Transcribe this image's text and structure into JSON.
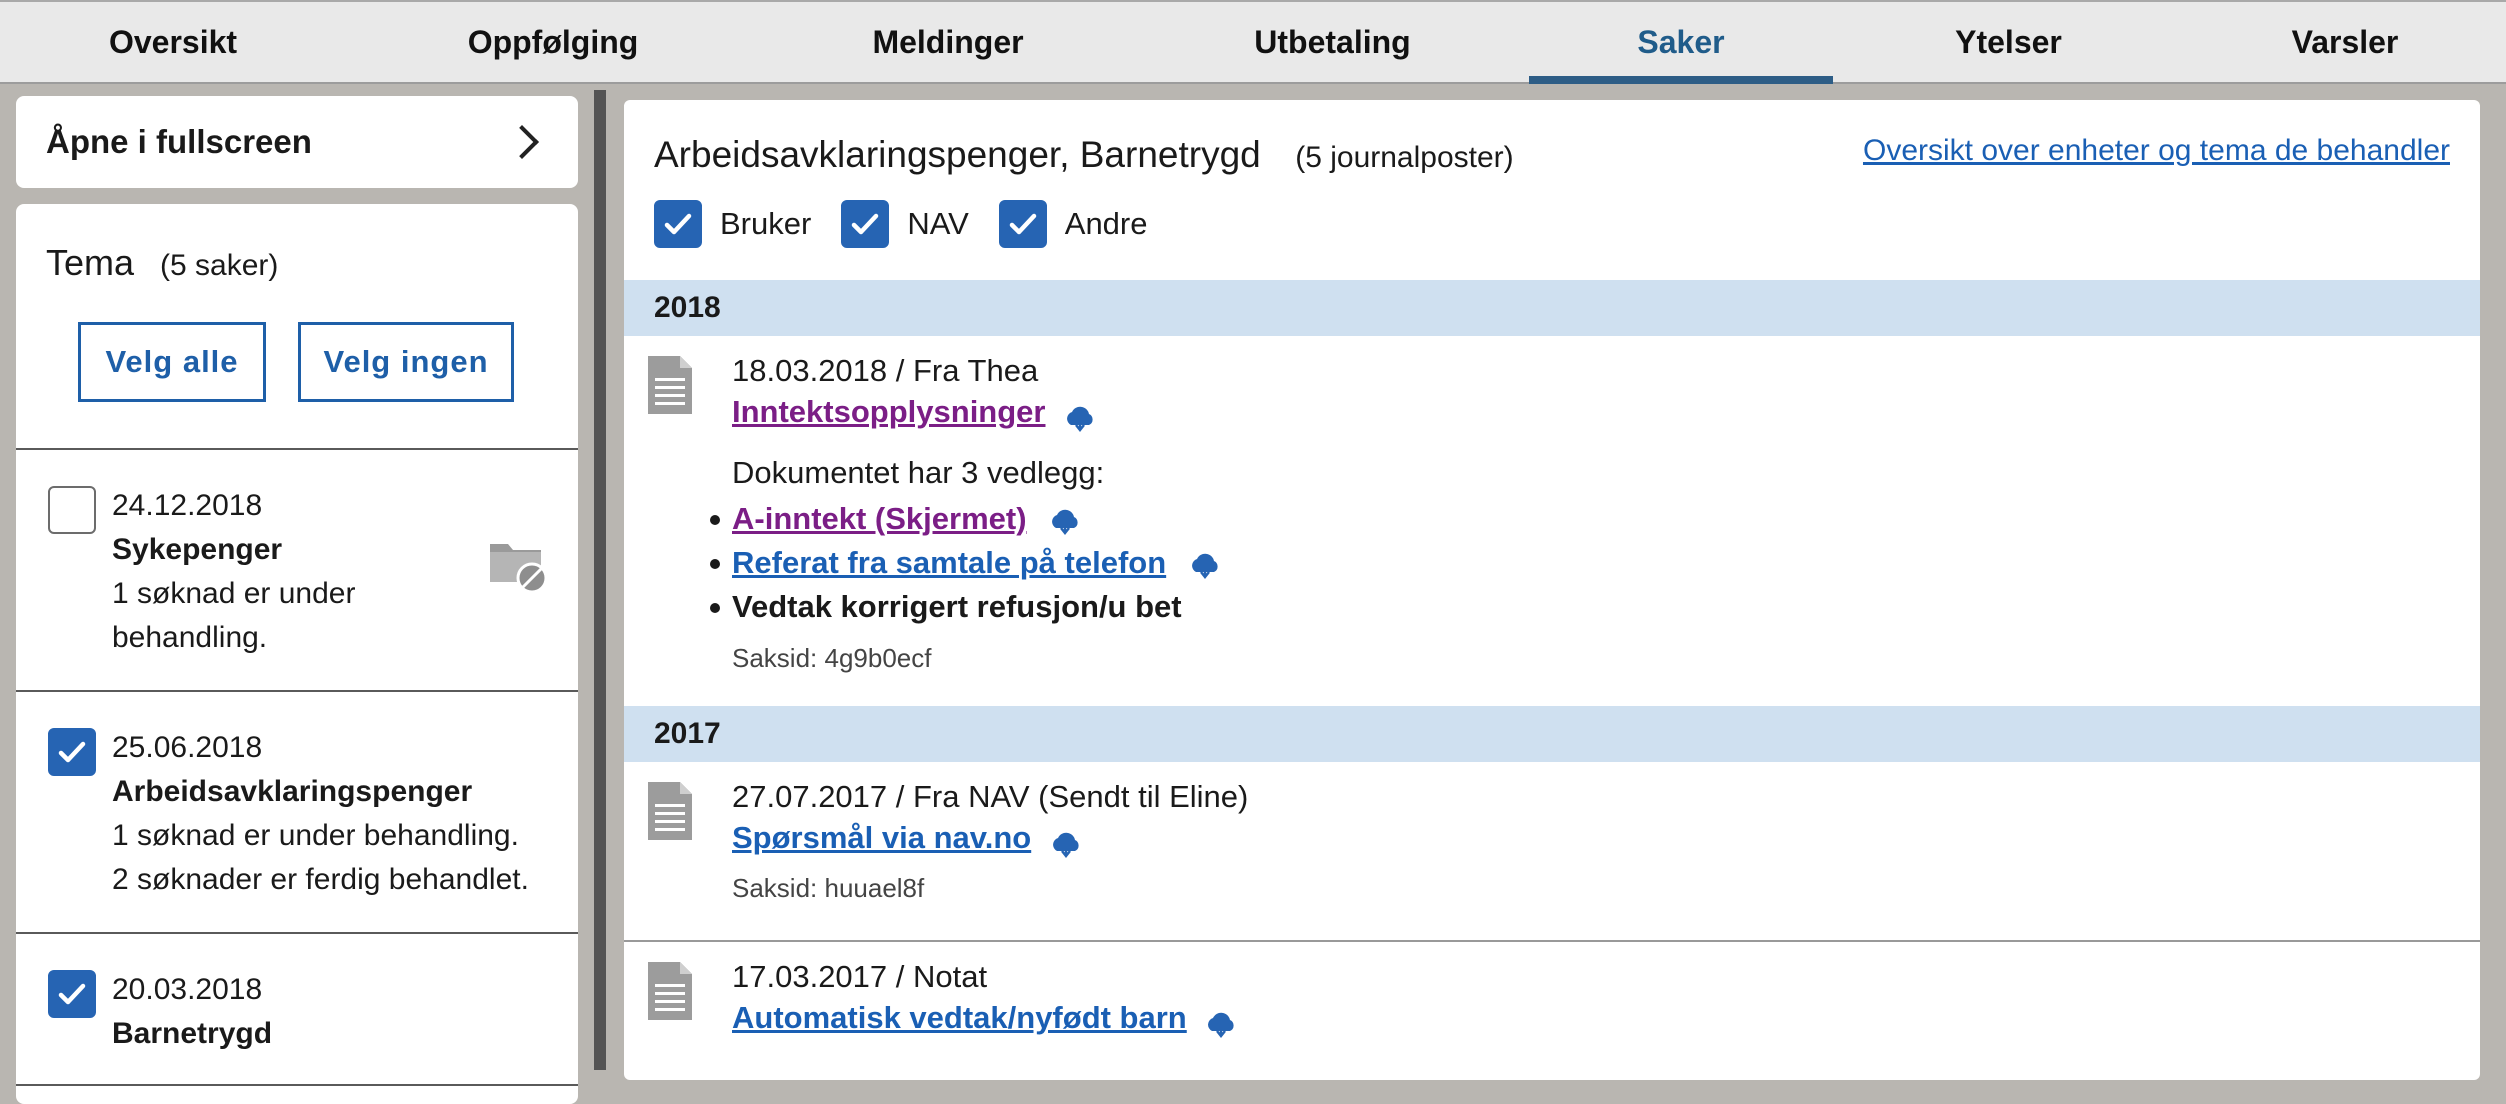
{
  "tabs": [
    {
      "label": "Oversikt",
      "active": false
    },
    {
      "label": "Oppfølging",
      "active": false
    },
    {
      "label": "Meldinger",
      "active": false
    },
    {
      "label": "Utbetaling",
      "active": false
    },
    {
      "label": "Saker",
      "active": true
    },
    {
      "label": "Ytelser",
      "active": false
    },
    {
      "label": "Varsler",
      "active": false
    }
  ],
  "sidebar": {
    "fullscreen_label": "Åpne i fullscreen",
    "tema_title": "Tema",
    "tema_count": "(5 saker)",
    "select_all_label": "Velg alle",
    "select_none_label": "Velg ingen",
    "saker": [
      {
        "date": "24.12.2018",
        "name": "Sykepenger",
        "status_lines": [
          "1 søknad er under",
          "behandling."
        ],
        "checked": false
      },
      {
        "date": "25.06.2018",
        "name": "Arbeidsavklaringspenger",
        "status_lines": [
          "1 søknad er under behandling.",
          "2 søknader er ferdig behandlet."
        ],
        "checked": true
      },
      {
        "date": "20.03.2018",
        "name": "Barnetrygd",
        "status_lines": [],
        "checked": true
      }
    ]
  },
  "main": {
    "title": "Arbeidsavklaringspenger, Barnetrygd",
    "journal_count": "(5 journalposter)",
    "overview_link": "Oversikt over enheter og tema de behandler",
    "filters": [
      {
        "label": "Bruker",
        "checked": true
      },
      {
        "label": "NAV",
        "checked": true
      },
      {
        "label": "Andre",
        "checked": true
      }
    ],
    "years": [
      {
        "year": "2018",
        "entries": [
          {
            "meta": "18.03.2018 / Fra Thea",
            "title": "Inntektsopplysninger",
            "visited": true,
            "vedlegg_title": "Dokumentet har 3 vedlegg:",
            "vedlegg": [
              {
                "label": "A-inntekt (Skjermet)",
                "type": "visited"
              },
              {
                "label": "Referat fra samtale på telefon",
                "type": "link"
              },
              {
                "label": "Vedtak korrigert refusjon/u bet",
                "type": "plain"
              }
            ],
            "saksid": "Saksid: 4g9b0ecf"
          }
        ]
      },
      {
        "year": "2017",
        "entries": [
          {
            "meta": "27.07.2017 / Fra NAV (Sendt til Eline)",
            "title": "Spørsmål via nav.no",
            "visited": false,
            "saksid": "Saksid: huuael8f"
          },
          {
            "meta": "17.03.2017 / Notat",
            "title": "Automatisk vedtak/nyfødt barn",
            "visited": false
          }
        ]
      }
    ]
  },
  "colors": {
    "accent": "#2664b3",
    "active_tab": "#205c8a",
    "year_band": "#cfe0f0",
    "visited_link": "#7b1e86",
    "link": "#1a5fb4"
  },
  "icons": [
    "chevron-right-icon",
    "checkmark-icon",
    "folder-blocked-icon",
    "document-icon",
    "cloud-download-icon"
  ]
}
